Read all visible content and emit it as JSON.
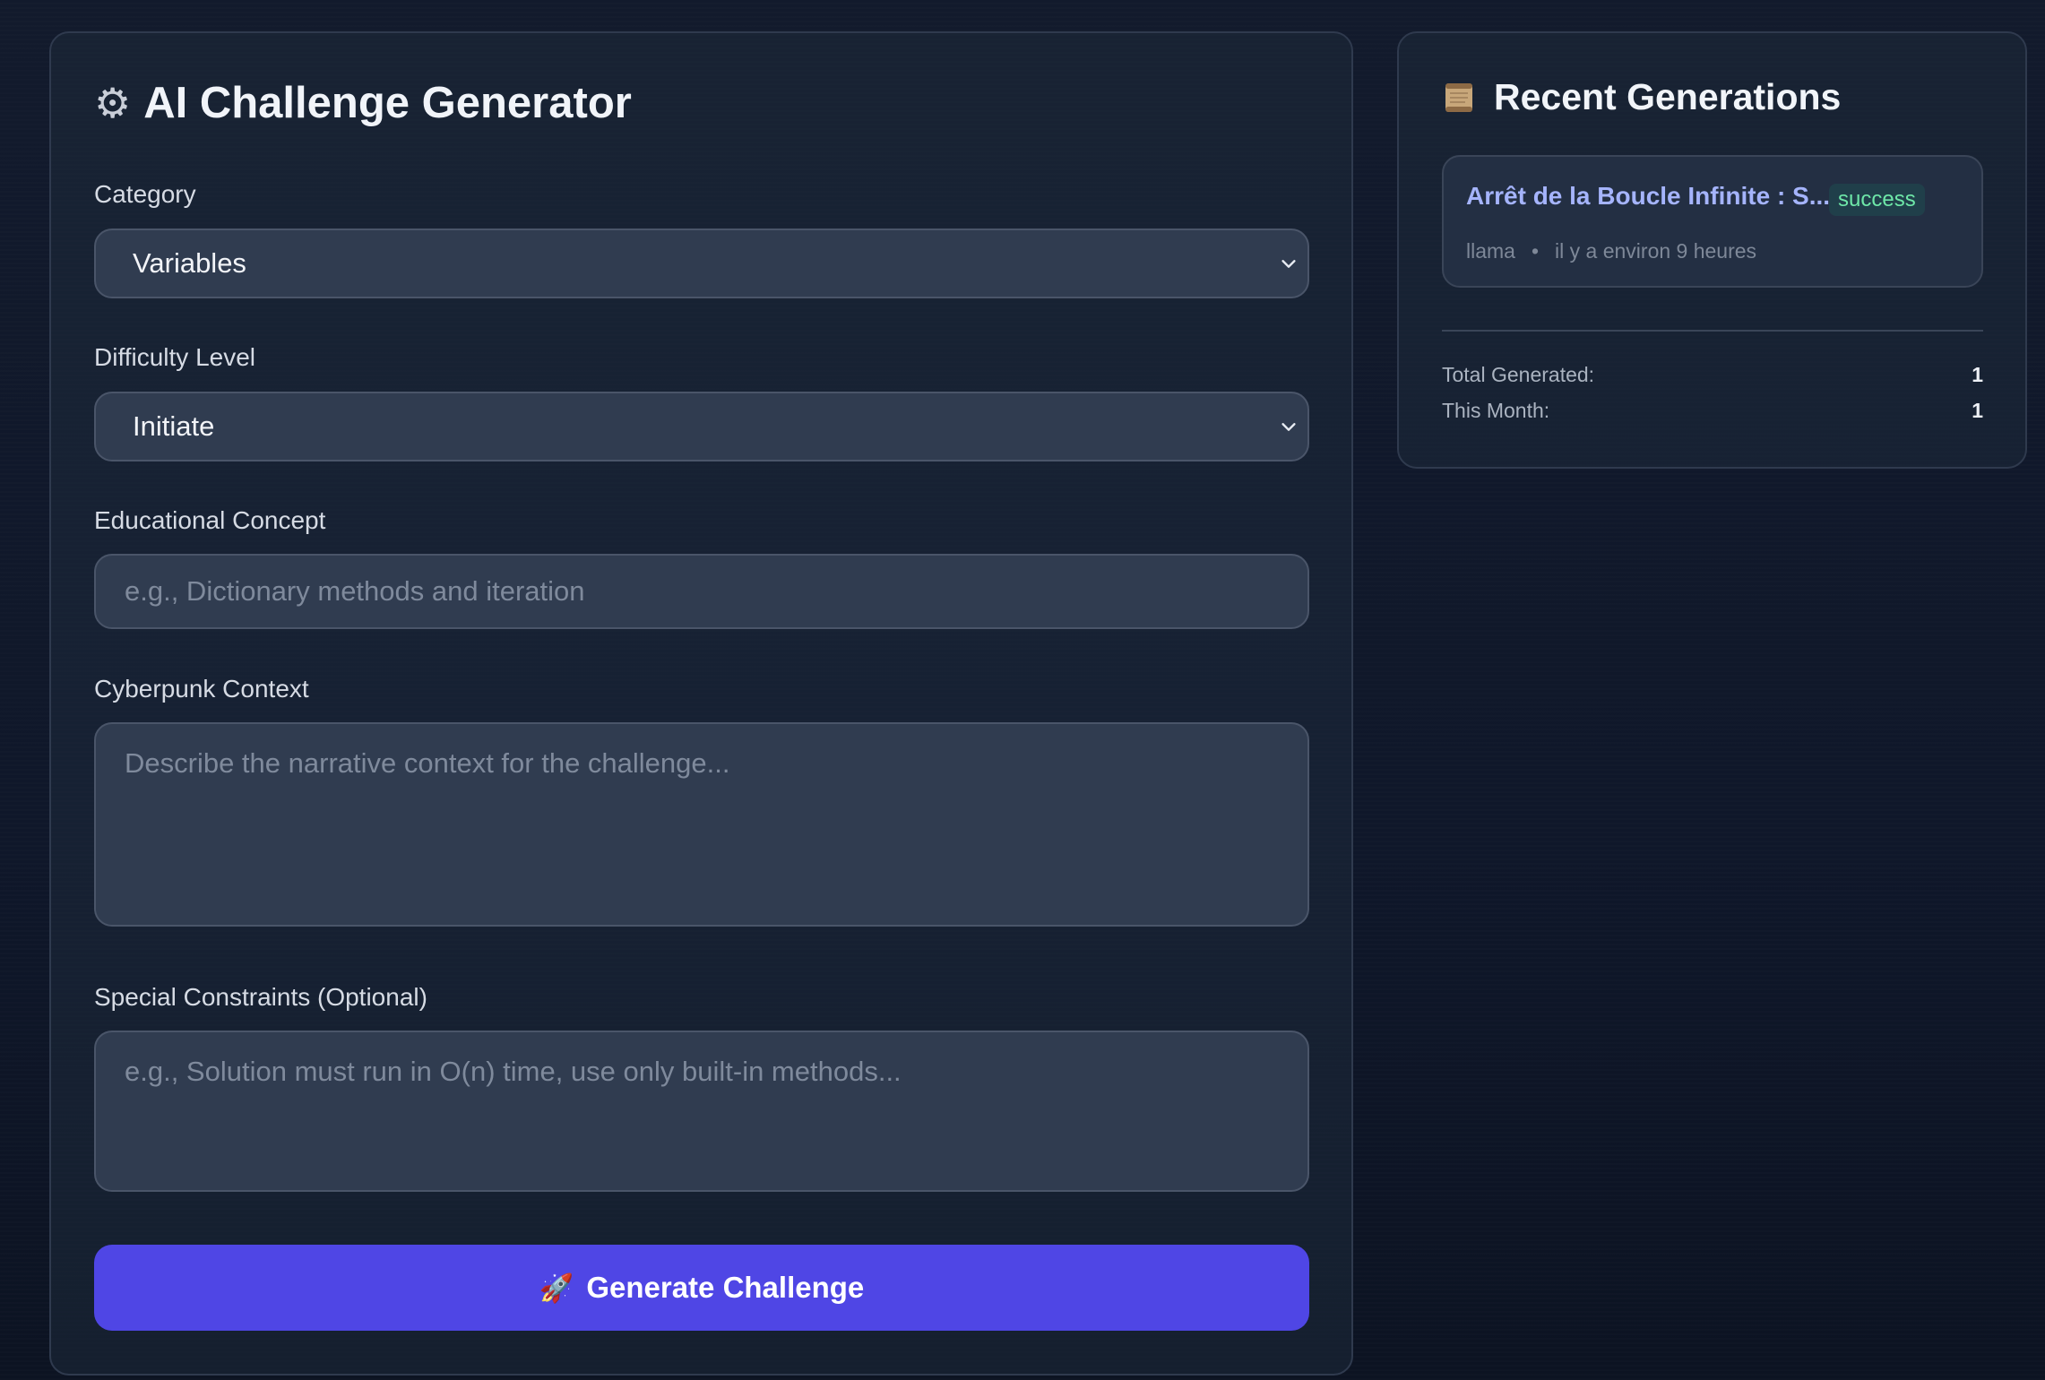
{
  "generator": {
    "title": "AI Challenge Generator",
    "icon": "gear-icon",
    "category_label": "Category",
    "category_value": "Variables",
    "difficulty_label": "Difficulty Level",
    "difficulty_value": "Initiate",
    "concept_label": "Educational Concept",
    "concept_placeholder": "e.g., Dictionary methods and iteration",
    "context_label": "Cyberpunk Context",
    "context_placeholder": "Describe the narrative context for the challenge...",
    "constraints_label": "Special Constraints (Optional)",
    "constraints_placeholder": "e.g., Solution must run in O(n) time, use only built-in methods...",
    "button_label": "Generate Challenge",
    "button_icon": "rocket-icon",
    "accent_color": "#4f46e5"
  },
  "recent": {
    "title": "Recent Generations",
    "icon": "scroll-icon",
    "items": [
      {
        "title": "Arrêt de la Boucle Infinite : S...",
        "status": "success",
        "model": "llama",
        "time": "il y a environ 9 heures"
      }
    ],
    "stats": {
      "total_label": "Total Generated:",
      "total_value": "1",
      "month_label": "This Month:",
      "month_value": "1"
    }
  }
}
